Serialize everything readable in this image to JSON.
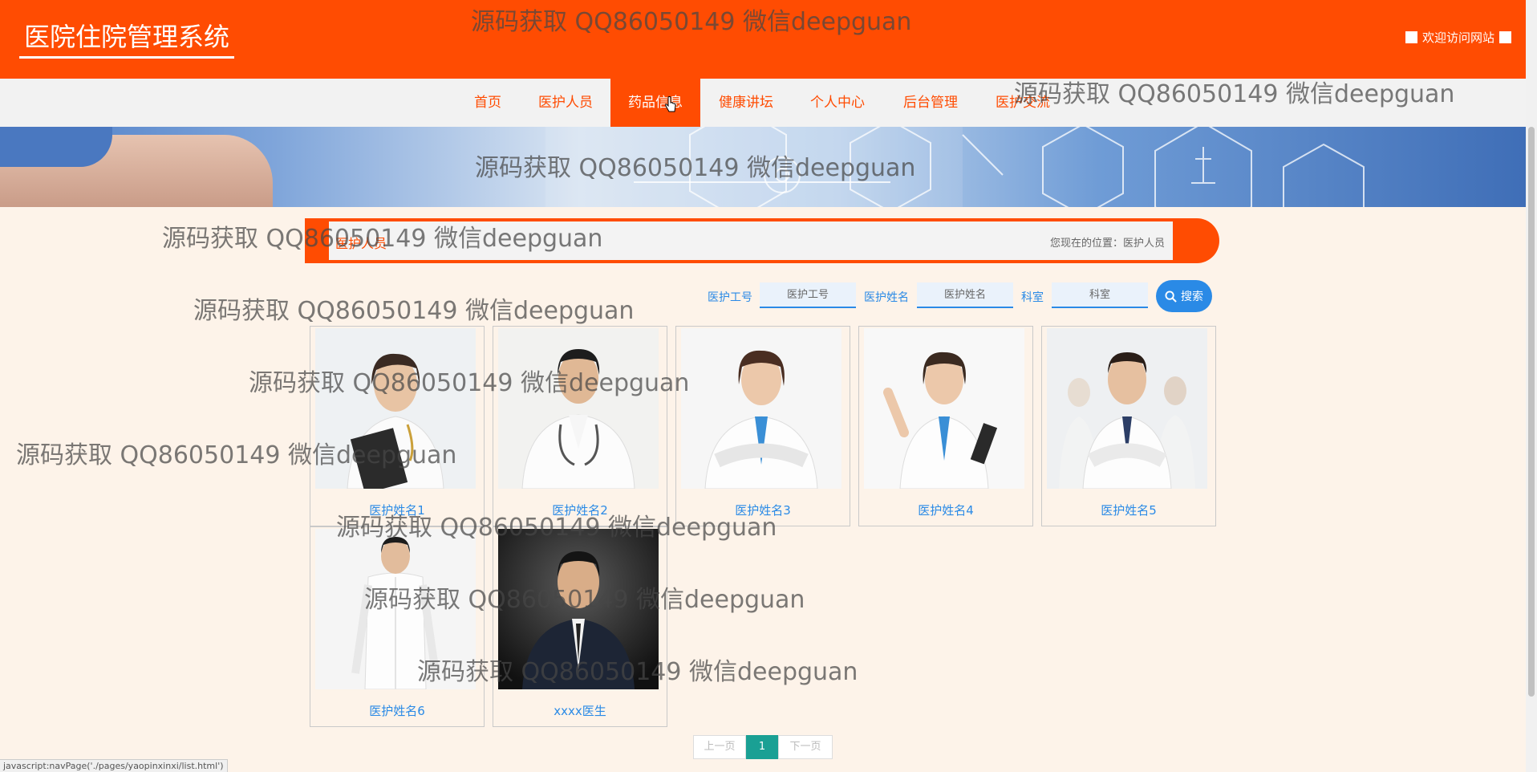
{
  "header": {
    "logo": "医院住院管理系统",
    "welcome": "欢迎访问网站"
  },
  "nav": {
    "items": [
      "首页",
      "医护人员",
      "药品信息",
      "健康讲坛",
      "个人中心",
      "后台管理",
      "医护交流"
    ],
    "active_index": 2
  },
  "section": {
    "title": "医护人员",
    "breadcrumb": "您现在的位置：医护人员"
  },
  "search": {
    "field1_label": "医护工号",
    "field1_placeholder": "医护工号",
    "field2_label": "医护姓名",
    "field2_placeholder": "医护姓名",
    "field3_label": "科室",
    "field3_placeholder": "科室",
    "button_label": "搜索"
  },
  "cards": [
    {
      "name": "医护姓名1"
    },
    {
      "name": "医护姓名2"
    },
    {
      "name": "医护姓名3"
    },
    {
      "name": "医护姓名4"
    },
    {
      "name": "医护姓名5"
    },
    {
      "name": "医护姓名6"
    },
    {
      "name": "xxxx医生"
    }
  ],
  "pagination": {
    "prev": "上一页",
    "current": "1",
    "next": "下一页"
  },
  "status_bar": "javascript:navPage('./pages/yaopinxinxi/list.html')",
  "watermark": "源码获取 QQ86050149 微信deepguan",
  "colors": {
    "brand": "#ff4c02",
    "link": "#2a8ae6",
    "page_bg": "#fdf3e9",
    "pager_active": "#1aa094"
  }
}
